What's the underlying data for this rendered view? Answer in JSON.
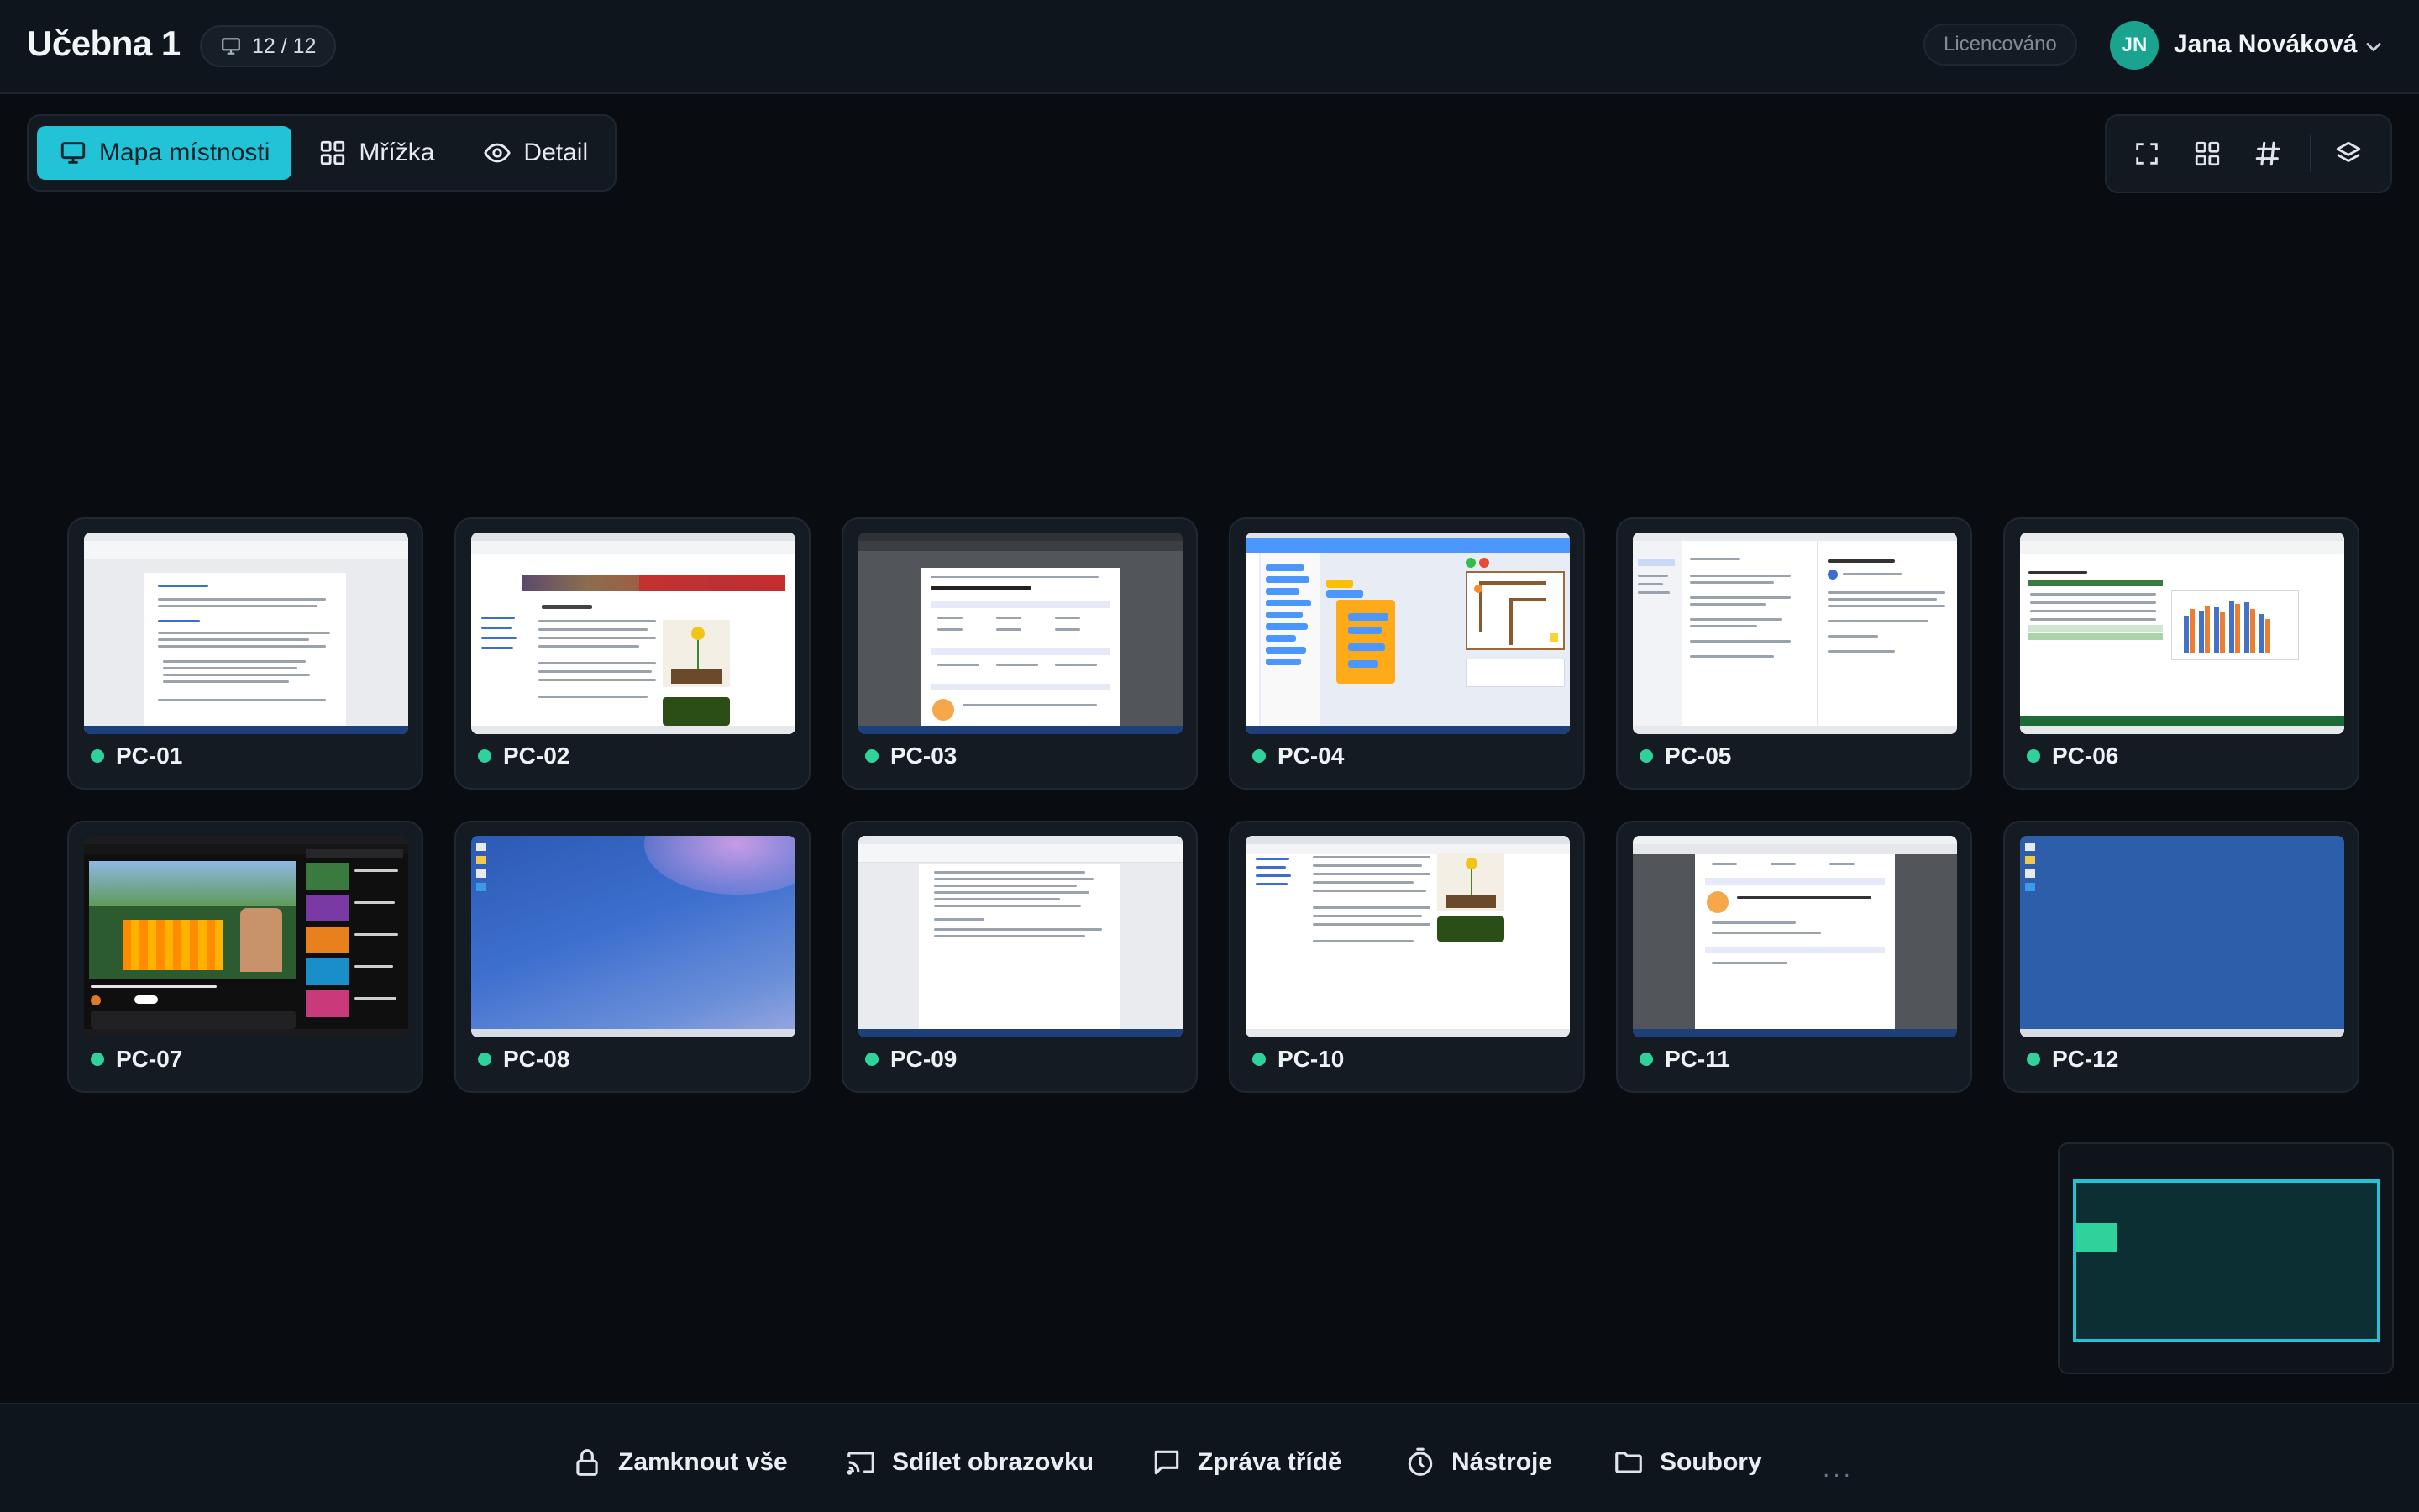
{
  "header": {
    "room_title": "Učebna 1",
    "pc_count": "12 / 12",
    "license": "Licencováno",
    "user_initials": "JN",
    "user_name": "Jana Nováková"
  },
  "views": {
    "room_map": "Mapa místnosti",
    "grid": "Mřížka",
    "detail": "Detail",
    "active": "room_map"
  },
  "toolbar_icons": [
    "fullscreen-icon",
    "grid-layout-icon",
    "hashtag-icon",
    "layers-icon"
  ],
  "computers": [
    {
      "name": "PC-01",
      "status": "online",
      "screen": "word-document"
    },
    {
      "name": "PC-02",
      "status": "online",
      "screen": "web-encyclopedia"
    },
    {
      "name": "PC-03",
      "status": "online",
      "screen": "pdf-worksheet"
    },
    {
      "name": "PC-04",
      "status": "online",
      "screen": "scratch-blocks"
    },
    {
      "name": "PC-05",
      "status": "online",
      "screen": "email-client"
    },
    {
      "name": "PC-06",
      "status": "online",
      "screen": "spreadsheet-chart"
    },
    {
      "name": "PC-07",
      "status": "online",
      "screen": "video-site"
    },
    {
      "name": "PC-08",
      "status": "online",
      "screen": "desktop-wallpaper"
    },
    {
      "name": "PC-09",
      "status": "online",
      "screen": "word-document"
    },
    {
      "name": "PC-10",
      "status": "online",
      "screen": "web-encyclopedia"
    },
    {
      "name": "PC-11",
      "status": "online",
      "screen": "pdf-worksheet"
    },
    {
      "name": "PC-12",
      "status": "online",
      "screen": "desktop-blue"
    }
  ],
  "actions": {
    "lock_all": "Zamknout vše",
    "share_screen": "Sdílet obrazovku",
    "message_class": "Zpráva třídě",
    "tools": "Nástroje",
    "files": "Soubory",
    "more": "..."
  },
  "colors": {
    "accent": "#22c3d6",
    "online": "#2fd29a",
    "background": "#090d12"
  }
}
